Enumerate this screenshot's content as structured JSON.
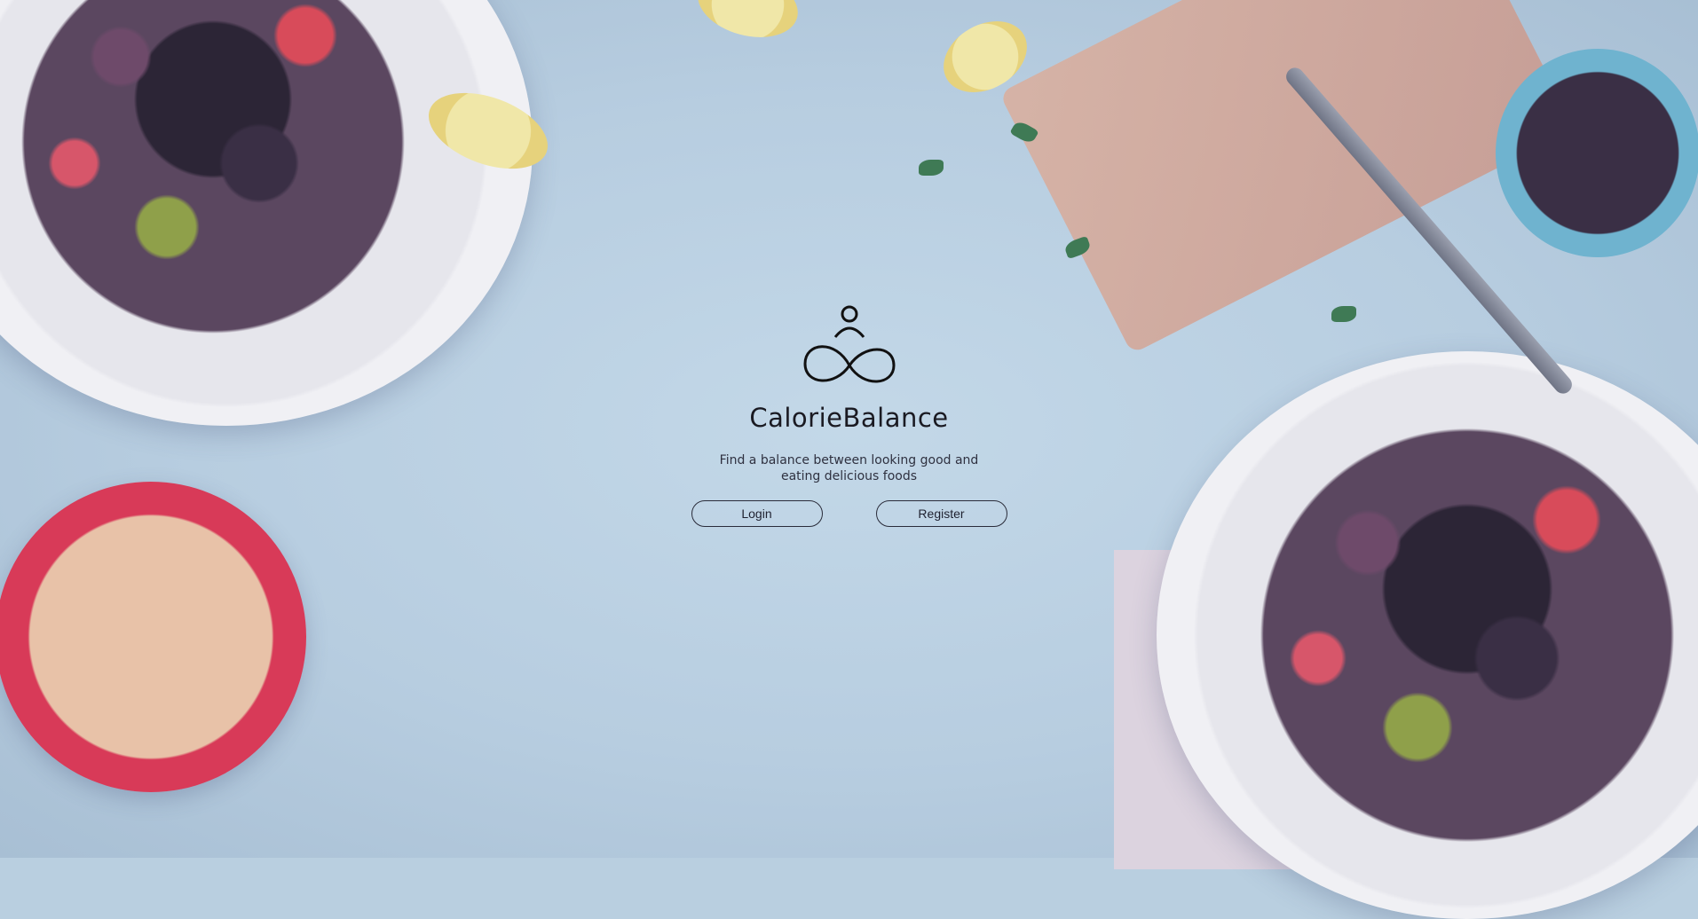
{
  "app": {
    "name": "CalorieBalance",
    "tagline": "Find a balance between looking good and eating delicious foods"
  },
  "actions": {
    "login_label": "Login",
    "register_label": "Register"
  },
  "icons": {
    "logo": "meditating-person-infinity-icon"
  }
}
